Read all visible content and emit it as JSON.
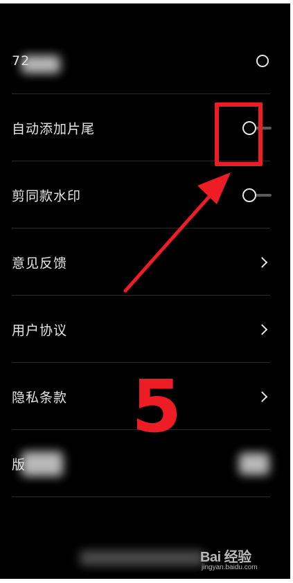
{
  "settings": {
    "rows": [
      {
        "label": "72",
        "control": "radio"
      },
      {
        "label": "自动添加片尾",
        "control": "toggle-off"
      },
      {
        "label": "剪同款水印",
        "control": "toggle-off"
      },
      {
        "label": "意见反馈",
        "control": "chevron"
      },
      {
        "label": "用户协议",
        "control": "chevron"
      },
      {
        "label": "隐私条款",
        "control": "chevron"
      },
      {
        "label": "版",
        "control": "value"
      }
    ]
  },
  "annotation": {
    "step_number": "5",
    "color": "#ee1c25"
  },
  "watermark": {
    "brand": "Bai 经验",
    "url": "jingyan.baidu.com"
  },
  "colors": {
    "background": "#000000",
    "text": "#e6e6e6",
    "divider": "#2a2a2a"
  }
}
